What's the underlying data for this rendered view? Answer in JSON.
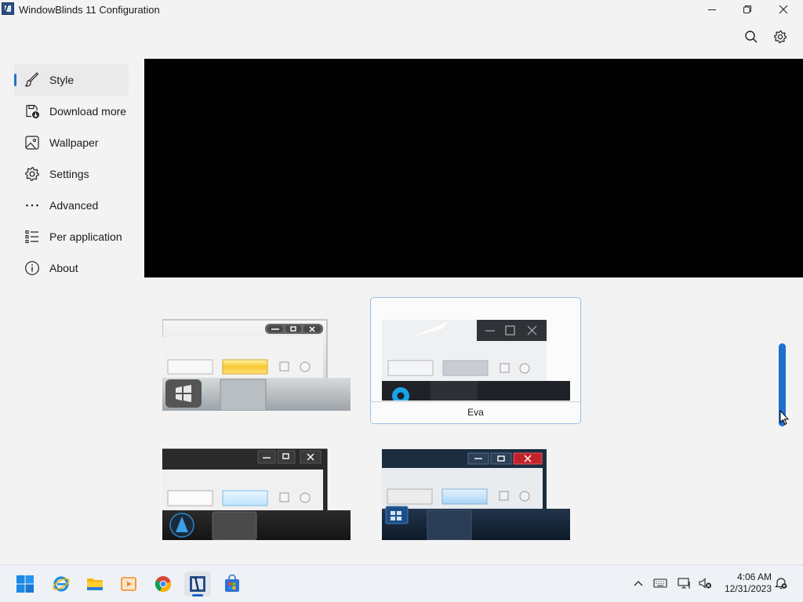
{
  "window": {
    "title": "WindowBlinds 11 Configuration",
    "minimize_icon": "minimize-icon",
    "restore_icon": "restore-icon",
    "close_icon": "close-icon"
  },
  "toolbar": {
    "search_icon": "search-icon",
    "settings_icon": "gear-icon"
  },
  "sidebar": {
    "items": [
      {
        "label": "Style",
        "icon": "brush-icon",
        "active": true
      },
      {
        "label": "Download more s",
        "icon": "download-icon",
        "active": false
      },
      {
        "label": "Wallpaper",
        "icon": "image-icon",
        "active": false
      },
      {
        "label": "Settings",
        "icon": "gear-icon",
        "active": false
      },
      {
        "label": "Advanced",
        "icon": "more-icon",
        "active": false
      },
      {
        "label": "Per application",
        "icon": "list-icon",
        "active": false
      },
      {
        "label": "About",
        "icon": "info-icon",
        "active": false
      }
    ]
  },
  "skins": [
    {
      "name": "",
      "selected": false
    },
    {
      "name": "Eva",
      "selected": true
    },
    {
      "name": "",
      "selected": false
    },
    {
      "name": "",
      "selected": false
    }
  ],
  "taskbar": {
    "apps": [
      "start-icon",
      "internet-explorer-icon",
      "file-explorer-icon",
      "media-player-icon",
      "chrome-icon",
      "windowblinds-icon",
      "store-icon"
    ],
    "tray": [
      "chevron-up-icon",
      "keyboard-icon",
      "display-icon",
      "volume-muted-icon",
      "notification-icon"
    ],
    "time": "4:06 AM",
    "date": "12/31/2023"
  },
  "colors": {
    "accent": "#1f6fd1",
    "selected_border": "#9cbde8",
    "preview_bg": "#000000"
  }
}
